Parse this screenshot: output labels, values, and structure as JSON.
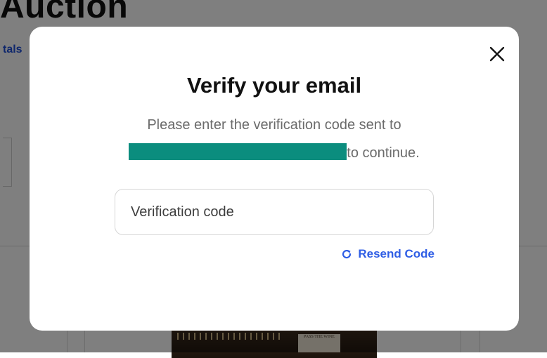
{
  "background": {
    "page_title": "Auction",
    "link_fragment": "tals",
    "image_sign": "PASS THE WINE"
  },
  "modal": {
    "title": "Verify your email",
    "instruction_line1": "Please enter the verification code sent to",
    "instruction_line2_suffix": "to continue.",
    "code_input": {
      "placeholder": "Verification code",
      "value": ""
    },
    "resend_label": "Resend Code",
    "accent_color": "#2f5ee5",
    "redaction_color": "#0b8d7e",
    "icons": {
      "close": "close-icon",
      "resend": "refresh-icon"
    }
  }
}
